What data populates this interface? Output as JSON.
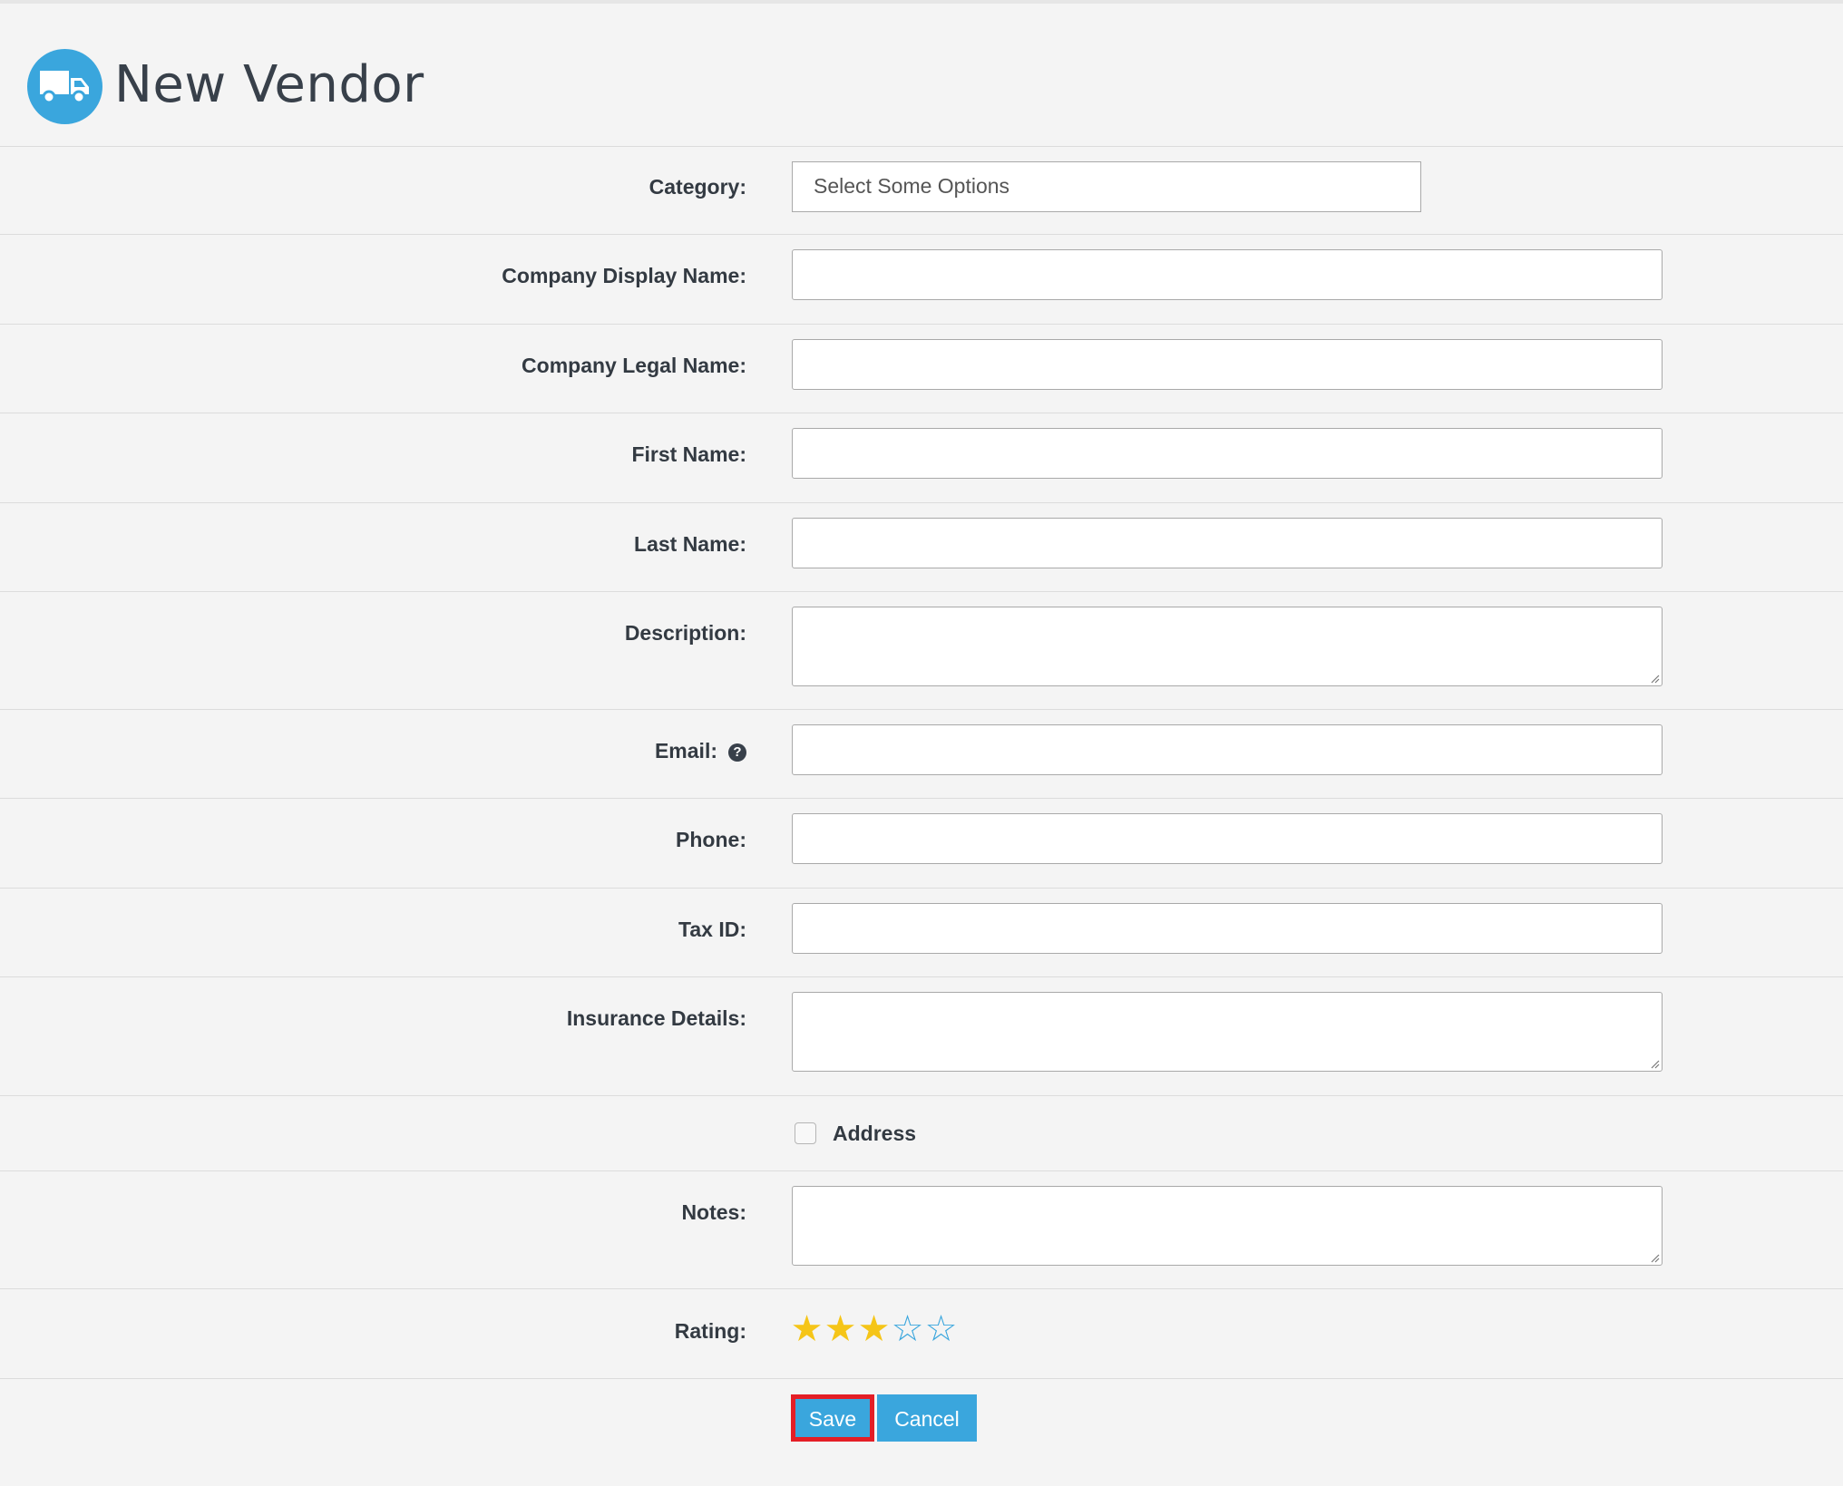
{
  "header": {
    "title": "New Vendor",
    "icon": "truck-icon",
    "icon_bg": "#3aa6dd"
  },
  "form": {
    "category": {
      "label": "Category:",
      "placeholder": "Select Some Options"
    },
    "company_display_name": {
      "label": "Company Display Name:",
      "value": ""
    },
    "company_legal_name": {
      "label": "Company Legal Name:",
      "value": ""
    },
    "first_name": {
      "label": "First Name:",
      "value": ""
    },
    "last_name": {
      "label": "Last Name:",
      "value": ""
    },
    "description": {
      "label": "Description:",
      "value": ""
    },
    "email": {
      "label": "Email:",
      "value": "",
      "help_icon": "question-circle-icon"
    },
    "phone": {
      "label": "Phone:",
      "value": ""
    },
    "tax_id": {
      "label": "Tax ID:",
      "value": ""
    },
    "insurance_details": {
      "label": "Insurance Details:",
      "value": ""
    },
    "address": {
      "label": "Address",
      "checked": false
    },
    "notes": {
      "label": "Notes:",
      "value": ""
    },
    "rating": {
      "label": "Rating:",
      "value": 3,
      "max": 5,
      "filled_color": "#f5c518",
      "empty_color": "#3aa6dd"
    }
  },
  "actions": {
    "save_label": "Save",
    "cancel_label": "Cancel",
    "accent": "#3aa6dd",
    "highlight": "#e41e26"
  }
}
